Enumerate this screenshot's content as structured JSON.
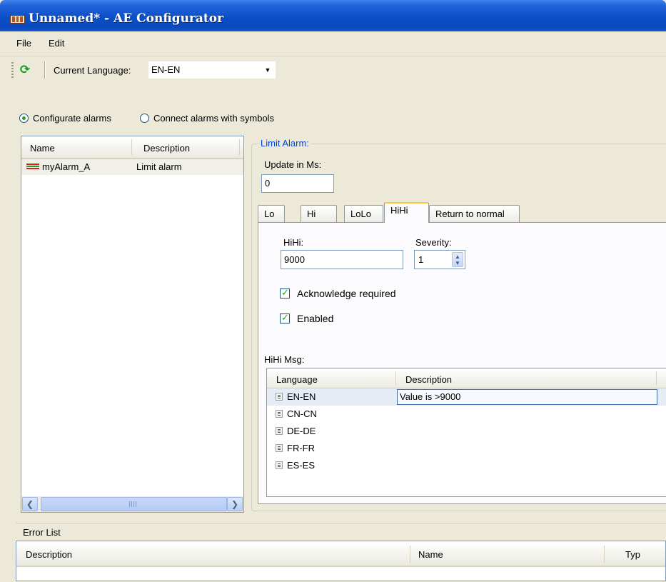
{
  "window": {
    "title": "Unnamed* - AE Configurator"
  },
  "menu": {
    "items": [
      "File",
      "Edit"
    ]
  },
  "toolbar": {
    "language_label": "Current Language:",
    "language_value": "EN-EN"
  },
  "mode": {
    "configurate": "Configurate alarms",
    "connect": "Connect alarms with symbols",
    "selected": "Configurate alarms"
  },
  "alarm_list": {
    "columns": [
      "Name",
      "Description"
    ],
    "rows": [
      {
        "name": "myAlarm_A",
        "description": "Limit alarm"
      }
    ],
    "icon_colors": [
      "#d62020",
      "#21a121",
      "#d62020"
    ]
  },
  "limit_alarm": {
    "group_title": "Limit Alarm:",
    "update_label": "Update in Ms:",
    "update_value": "0",
    "tabs": [
      "Lo",
      "Hi",
      "LoLo",
      "HiHi",
      "Return to normal"
    ],
    "active_tab": "HiHi",
    "hihi_label": "HiHi:",
    "hihi_value": "9000",
    "severity_label": "Severity:",
    "severity_value": "1",
    "acknowledge_label": "Acknowledge required",
    "acknowledge_checked": true,
    "enabled_label": "Enabled",
    "enabled_checked": true,
    "msg_label": "HiHi Msg:",
    "msg_columns": [
      "Language",
      "Description"
    ],
    "msg_rows": [
      {
        "language": "EN-EN",
        "description": "Value is >9000"
      },
      {
        "language": "CN-CN",
        "description": ""
      },
      {
        "language": "DE-DE",
        "description": ""
      },
      {
        "language": "FR-FR",
        "description": ""
      },
      {
        "language": "ES-ES",
        "description": ""
      }
    ]
  },
  "error_list": {
    "title": "Error List",
    "columns": [
      "Description",
      "Name",
      "Typ"
    ]
  },
  "colors": {
    "title_bar": "#0a50c8",
    "accent_link": "#0046d5",
    "tab_highlight": "#ffc83c",
    "check_green": "#21a121"
  }
}
